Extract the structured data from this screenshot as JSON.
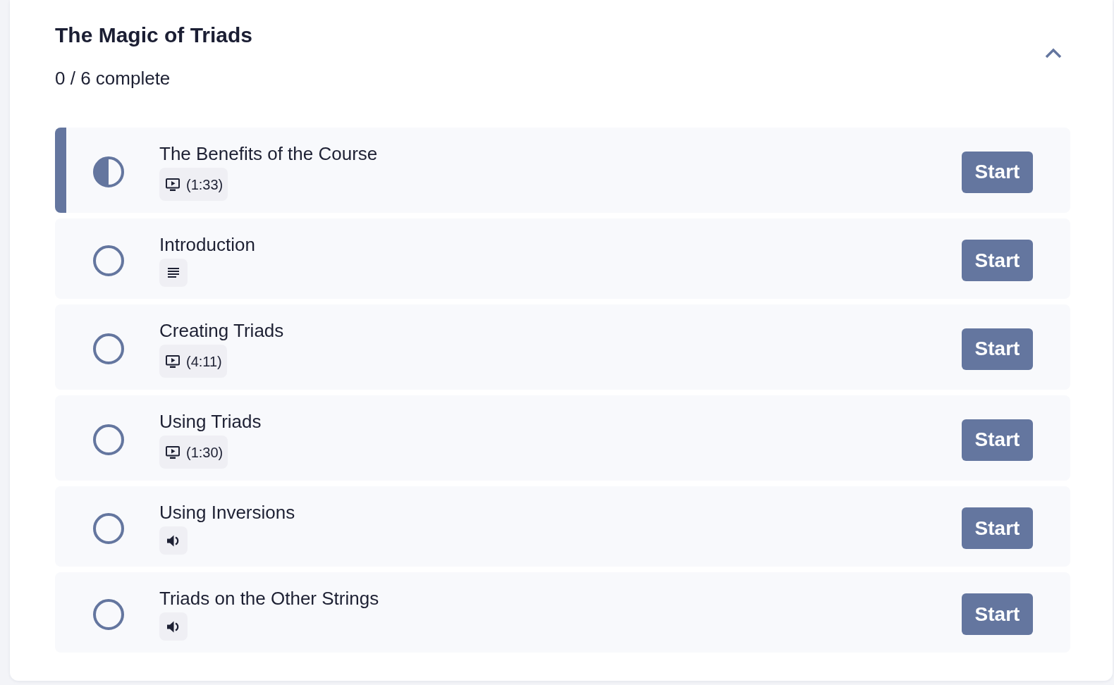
{
  "section": {
    "title": "The Magic of Triads",
    "progress": "0 / 6 complete",
    "expanded": true
  },
  "lessons": [
    {
      "title": "The Benefits of the Course",
      "kind": "video",
      "duration": "(1:33)",
      "selected": true,
      "started": true,
      "button": "Start"
    },
    {
      "title": "Introduction",
      "kind": "text",
      "selected": false,
      "started": false,
      "button": "Start"
    },
    {
      "title": "Creating Triads",
      "kind": "video",
      "duration": "(4:11)",
      "selected": false,
      "started": false,
      "button": "Start"
    },
    {
      "title": "Using Triads",
      "kind": "video",
      "duration": "(1:30)",
      "selected": false,
      "started": false,
      "button": "Start"
    },
    {
      "title": "Using Inversions",
      "kind": "audio",
      "selected": false,
      "started": false,
      "button": "Start"
    },
    {
      "title": "Triads on the Other Strings",
      "kind": "audio",
      "selected": false,
      "started": false,
      "button": "Start"
    }
  ]
}
